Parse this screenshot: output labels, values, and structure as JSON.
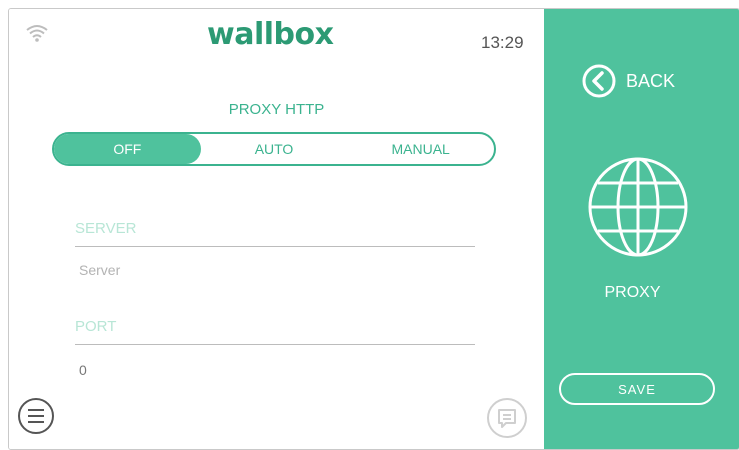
{
  "header": {
    "logo_text": "wallbox",
    "time": "13:29",
    "wifi_icon": "wifi-icon"
  },
  "proxy": {
    "title": "PROXY HTTP",
    "modes": [
      "OFF",
      "AUTO",
      "MANUAL"
    ],
    "selected_mode": "OFF"
  },
  "form": {
    "server": {
      "label": "SERVER",
      "placeholder": "Server",
      "value": ""
    },
    "port": {
      "label": "PORT",
      "placeholder": "",
      "value": "0"
    }
  },
  "footer": {
    "menu_icon": "menu-icon",
    "chat_icon": "chat-icon"
  },
  "side_panel": {
    "back_label": "BACK",
    "section_icon": "globe-icon",
    "section_label": "PROXY",
    "save_label": "SAVE"
  },
  "colors": {
    "accent": "#4fc29d",
    "accent_dark": "#2c9a74",
    "accent_text": "#3bb38f",
    "field_label": "#b8e6d6"
  }
}
